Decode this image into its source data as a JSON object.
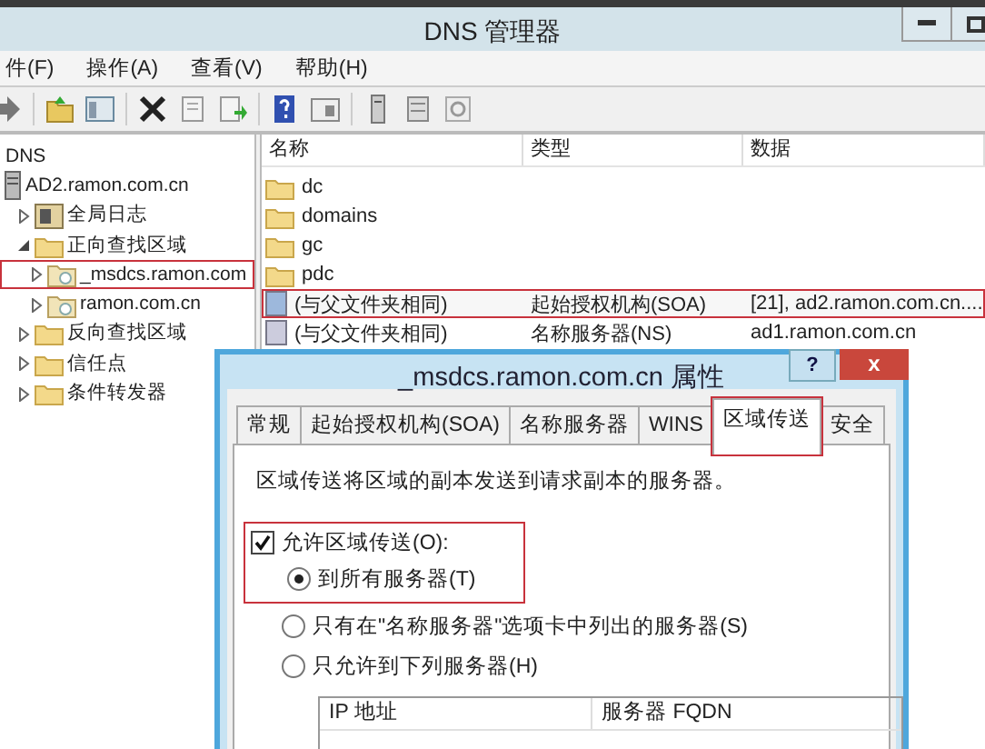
{
  "window": {
    "title": "DNS 管理器"
  },
  "menu": [
    "件(F)",
    "操作(A)",
    "查看(V)",
    "帮助(H)"
  ],
  "tree": {
    "root": "DNS",
    "items": [
      {
        "label": "AD2.ramon.com.cn",
        "kind": "server",
        "children": [
          {
            "label": "全局日志",
            "kind": "log",
            "expanded": false,
            "highlighted": false
          },
          {
            "label": "正向查找区域",
            "kind": "folder",
            "expanded": true,
            "highlighted": false,
            "children": [
              {
                "label": "_msdcs.ramon.com",
                "kind": "zone",
                "expanded": false,
                "highlighted": true
              },
              {
                "label": "ramon.com.cn",
                "kind": "zone",
                "expanded": false,
                "highlighted": false
              }
            ]
          },
          {
            "label": "反向查找区域",
            "kind": "folder",
            "expanded": false,
            "highlighted": false
          },
          {
            "label": "信任点",
            "kind": "folder",
            "expanded": false,
            "highlighted": false
          },
          {
            "label": "条件转发器",
            "kind": "folder",
            "expanded": false,
            "highlighted": false
          }
        ]
      }
    ]
  },
  "list": {
    "columns": [
      "名称",
      "类型",
      "数据"
    ],
    "rows": [
      {
        "name": "dc",
        "kind": "folder",
        "highlighted": false
      },
      {
        "name": "domains",
        "kind": "folder",
        "highlighted": false
      },
      {
        "name": "gc",
        "kind": "folder",
        "highlighted": false
      },
      {
        "name": "pdc",
        "kind": "folder",
        "highlighted": false
      },
      {
        "name": "(与父文件夹相同)",
        "type": "起始授权机构(SOA)",
        "data": "[21], ad2.ramon.com.cn....",
        "kind": "record",
        "highlighted": true
      },
      {
        "name": "(与父文件夹相同)",
        "type": "名称服务器(NS)",
        "data": "ad1.ramon.com.cn",
        "kind": "record",
        "highlighted": false
      }
    ]
  },
  "dialog": {
    "title": "_msdcs.ramon.com.cn 属性",
    "help_button": "?",
    "close_button": "x",
    "tabs": [
      {
        "label": "常规",
        "selected": false,
        "highlighted": false
      },
      {
        "label": "起始授权机构(SOA)",
        "selected": false,
        "highlighted": false
      },
      {
        "label": "名称服务器",
        "selected": false,
        "highlighted": false
      },
      {
        "label": "WINS",
        "selected": false,
        "highlighted": false
      },
      {
        "label": "区域传送",
        "selected": true,
        "highlighted": true
      },
      {
        "label": "安全",
        "selected": false,
        "highlighted": false
      }
    ],
    "description": "区域传送将区域的副本发送到请求副本的服务器。",
    "allow_transfer": {
      "label": "允许区域传送(O):",
      "checked": true,
      "highlighted": true,
      "options": [
        {
          "label": "到所有服务器(T)",
          "selected": true
        },
        {
          "label": "只有在\"名称服务器\"选项卡中列出的服务器(S)",
          "selected": false
        },
        {
          "label": "只允许到下列服务器(H)",
          "selected": false
        }
      ]
    },
    "servers_table": {
      "columns": [
        "IP 地址",
        "服务器 FQDN"
      ]
    }
  }
}
